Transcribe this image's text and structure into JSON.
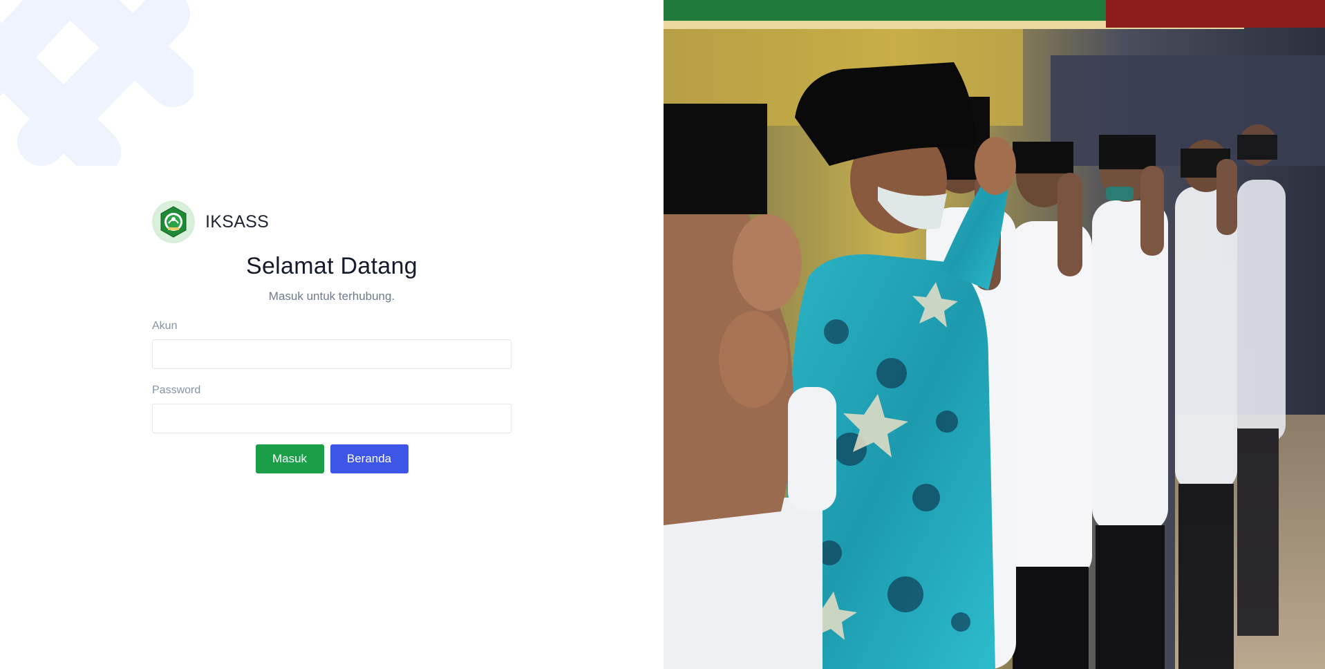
{
  "brand": {
    "name": "IKSASS",
    "logo_icon": "iksass-emblem-icon"
  },
  "login": {
    "title": "Selamat Datang",
    "subtitle": "Masuk untuk terhubung.",
    "account_label": "Akun",
    "account_value": "",
    "account_placeholder": "",
    "password_label": "Password",
    "password_value": "",
    "password_placeholder": "",
    "login_button": "Masuk",
    "home_button": "Beranda"
  },
  "colors": {
    "login_button": "#1a9e48",
    "home_button": "#3d56e8",
    "decor": "#eef3fd",
    "title": "#141a2c",
    "muted": "#8492a6"
  },
  "photo": {
    "icon": "saluting-men-photo"
  }
}
